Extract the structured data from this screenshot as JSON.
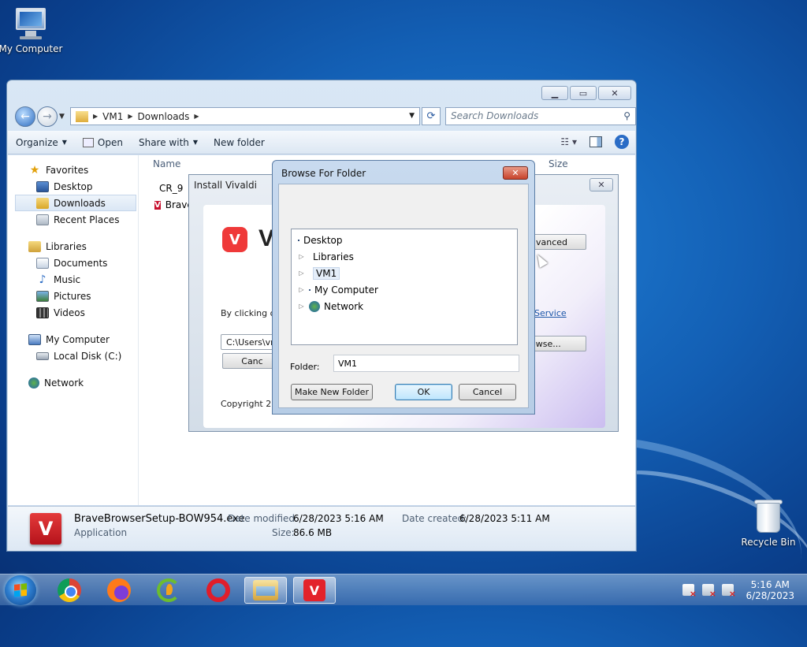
{
  "desktop": {
    "icons": [
      {
        "label": "My Computer"
      },
      {
        "label": "Recycle Bin"
      }
    ]
  },
  "explorer": {
    "address": {
      "crumbs": [
        "VM1",
        "Downloads"
      ]
    },
    "search_placeholder": "Search Downloads",
    "toolbar": {
      "organize": "Organize",
      "open": "Open",
      "share_with": "Share with",
      "new_folder": "New folder"
    },
    "nav": {
      "favorites": "Favorites",
      "desktop": "Desktop",
      "downloads": "Downloads",
      "recent_places": "Recent Places",
      "libraries": "Libraries",
      "documents": "Documents",
      "music": "Music",
      "pictures": "Pictures",
      "videos": "Videos",
      "my_computer": "My Computer",
      "local_disk": "Local Disk (C:)",
      "network": "Network"
    },
    "columns": {
      "name": "Name",
      "size": "Size"
    },
    "files": [
      {
        "name": "CR_9"
      },
      {
        "name": "Brave"
      }
    ],
    "details": {
      "filename": "BraveBrowserSetup-BOW954.exe",
      "type": "Application",
      "date_modified_label": "Date modified:",
      "date_modified": "6/28/2023 5:16 AM",
      "size_label": "Size:",
      "size": "86.6 MB",
      "date_created_label": "Date created:",
      "date_created": "6/28/2023 5:11 AM"
    }
  },
  "installer": {
    "title": "Install Vivaldi",
    "logo_text": "V",
    "advanced": "dvanced",
    "by_clicking": "By clicking on",
    "service_link": "Service",
    "path": "C:\\Users\\vm",
    "browse": "owse...",
    "cancel": "Canc",
    "copyright": "Copyright 202"
  },
  "browse_dialog": {
    "title": "Browse For Folder",
    "tree": [
      {
        "label": "Desktop"
      },
      {
        "label": "Libraries"
      },
      {
        "label": "VM1"
      },
      {
        "label": "My Computer"
      },
      {
        "label": "Network"
      }
    ],
    "folder_label": "Folder:",
    "folder_value": "VM1",
    "make_new_folder": "Make New Folder",
    "ok": "OK",
    "cancel": "Cancel"
  },
  "taskbar": {
    "time": "5:16 AM",
    "date": "6/28/2023"
  },
  "icons": {
    "back": "back-arrow-icon",
    "forward": "forward-arrow-icon",
    "refresh": "refresh-icon",
    "search": "search-icon",
    "help": "help-icon"
  }
}
